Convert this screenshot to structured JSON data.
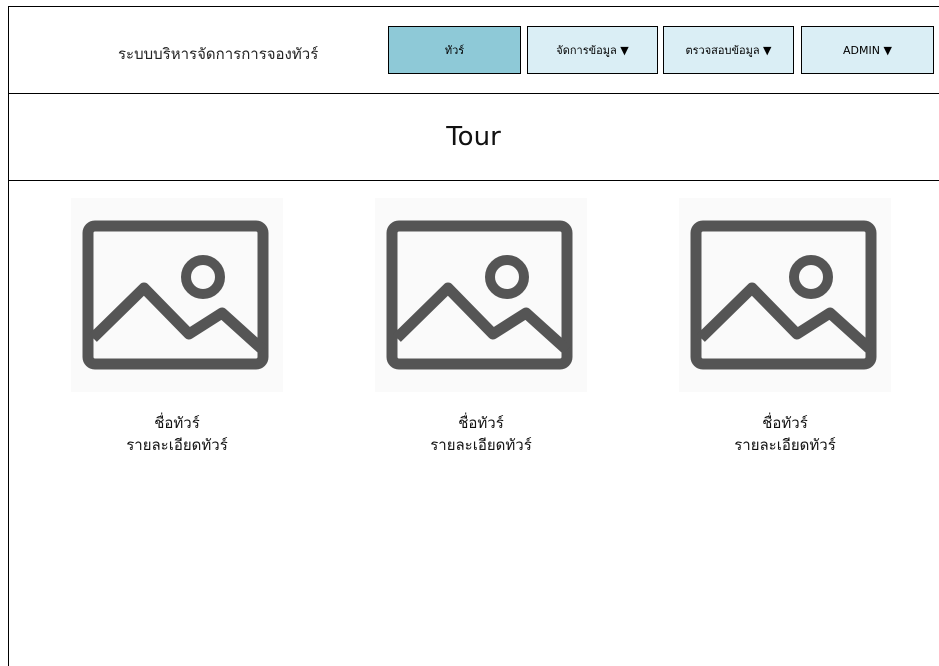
{
  "header": {
    "app_title": "ระบบบริหารจัดการการจองทัวร์",
    "nav": [
      {
        "label": "ทัวร์",
        "active": true
      },
      {
        "label": "จัดการข้อมูล ▼",
        "active": false
      },
      {
        "label": "ตรวจสอบข้อมูล ▼",
        "active": false
      },
      {
        "label": "ADMIN ▼",
        "active": false
      }
    ]
  },
  "page": {
    "title": "Tour"
  },
  "tours": [
    {
      "name": "ชื่อทัวร์",
      "detail": "รายละเอียดทัวร์",
      "image_icon": "image-placeholder-icon"
    },
    {
      "name": "ชื่อทัวร์",
      "detail": "รายละเอียดทัวร์",
      "image_icon": "image-placeholder-icon"
    },
    {
      "name": "ชื่อทัวร์",
      "detail": "รายละเอียดทัวร์",
      "image_icon": "image-placeholder-icon"
    }
  ],
  "colors": {
    "nav_active": "#8ec9d7",
    "nav_default": "#daeef5",
    "icon": "#555555"
  }
}
